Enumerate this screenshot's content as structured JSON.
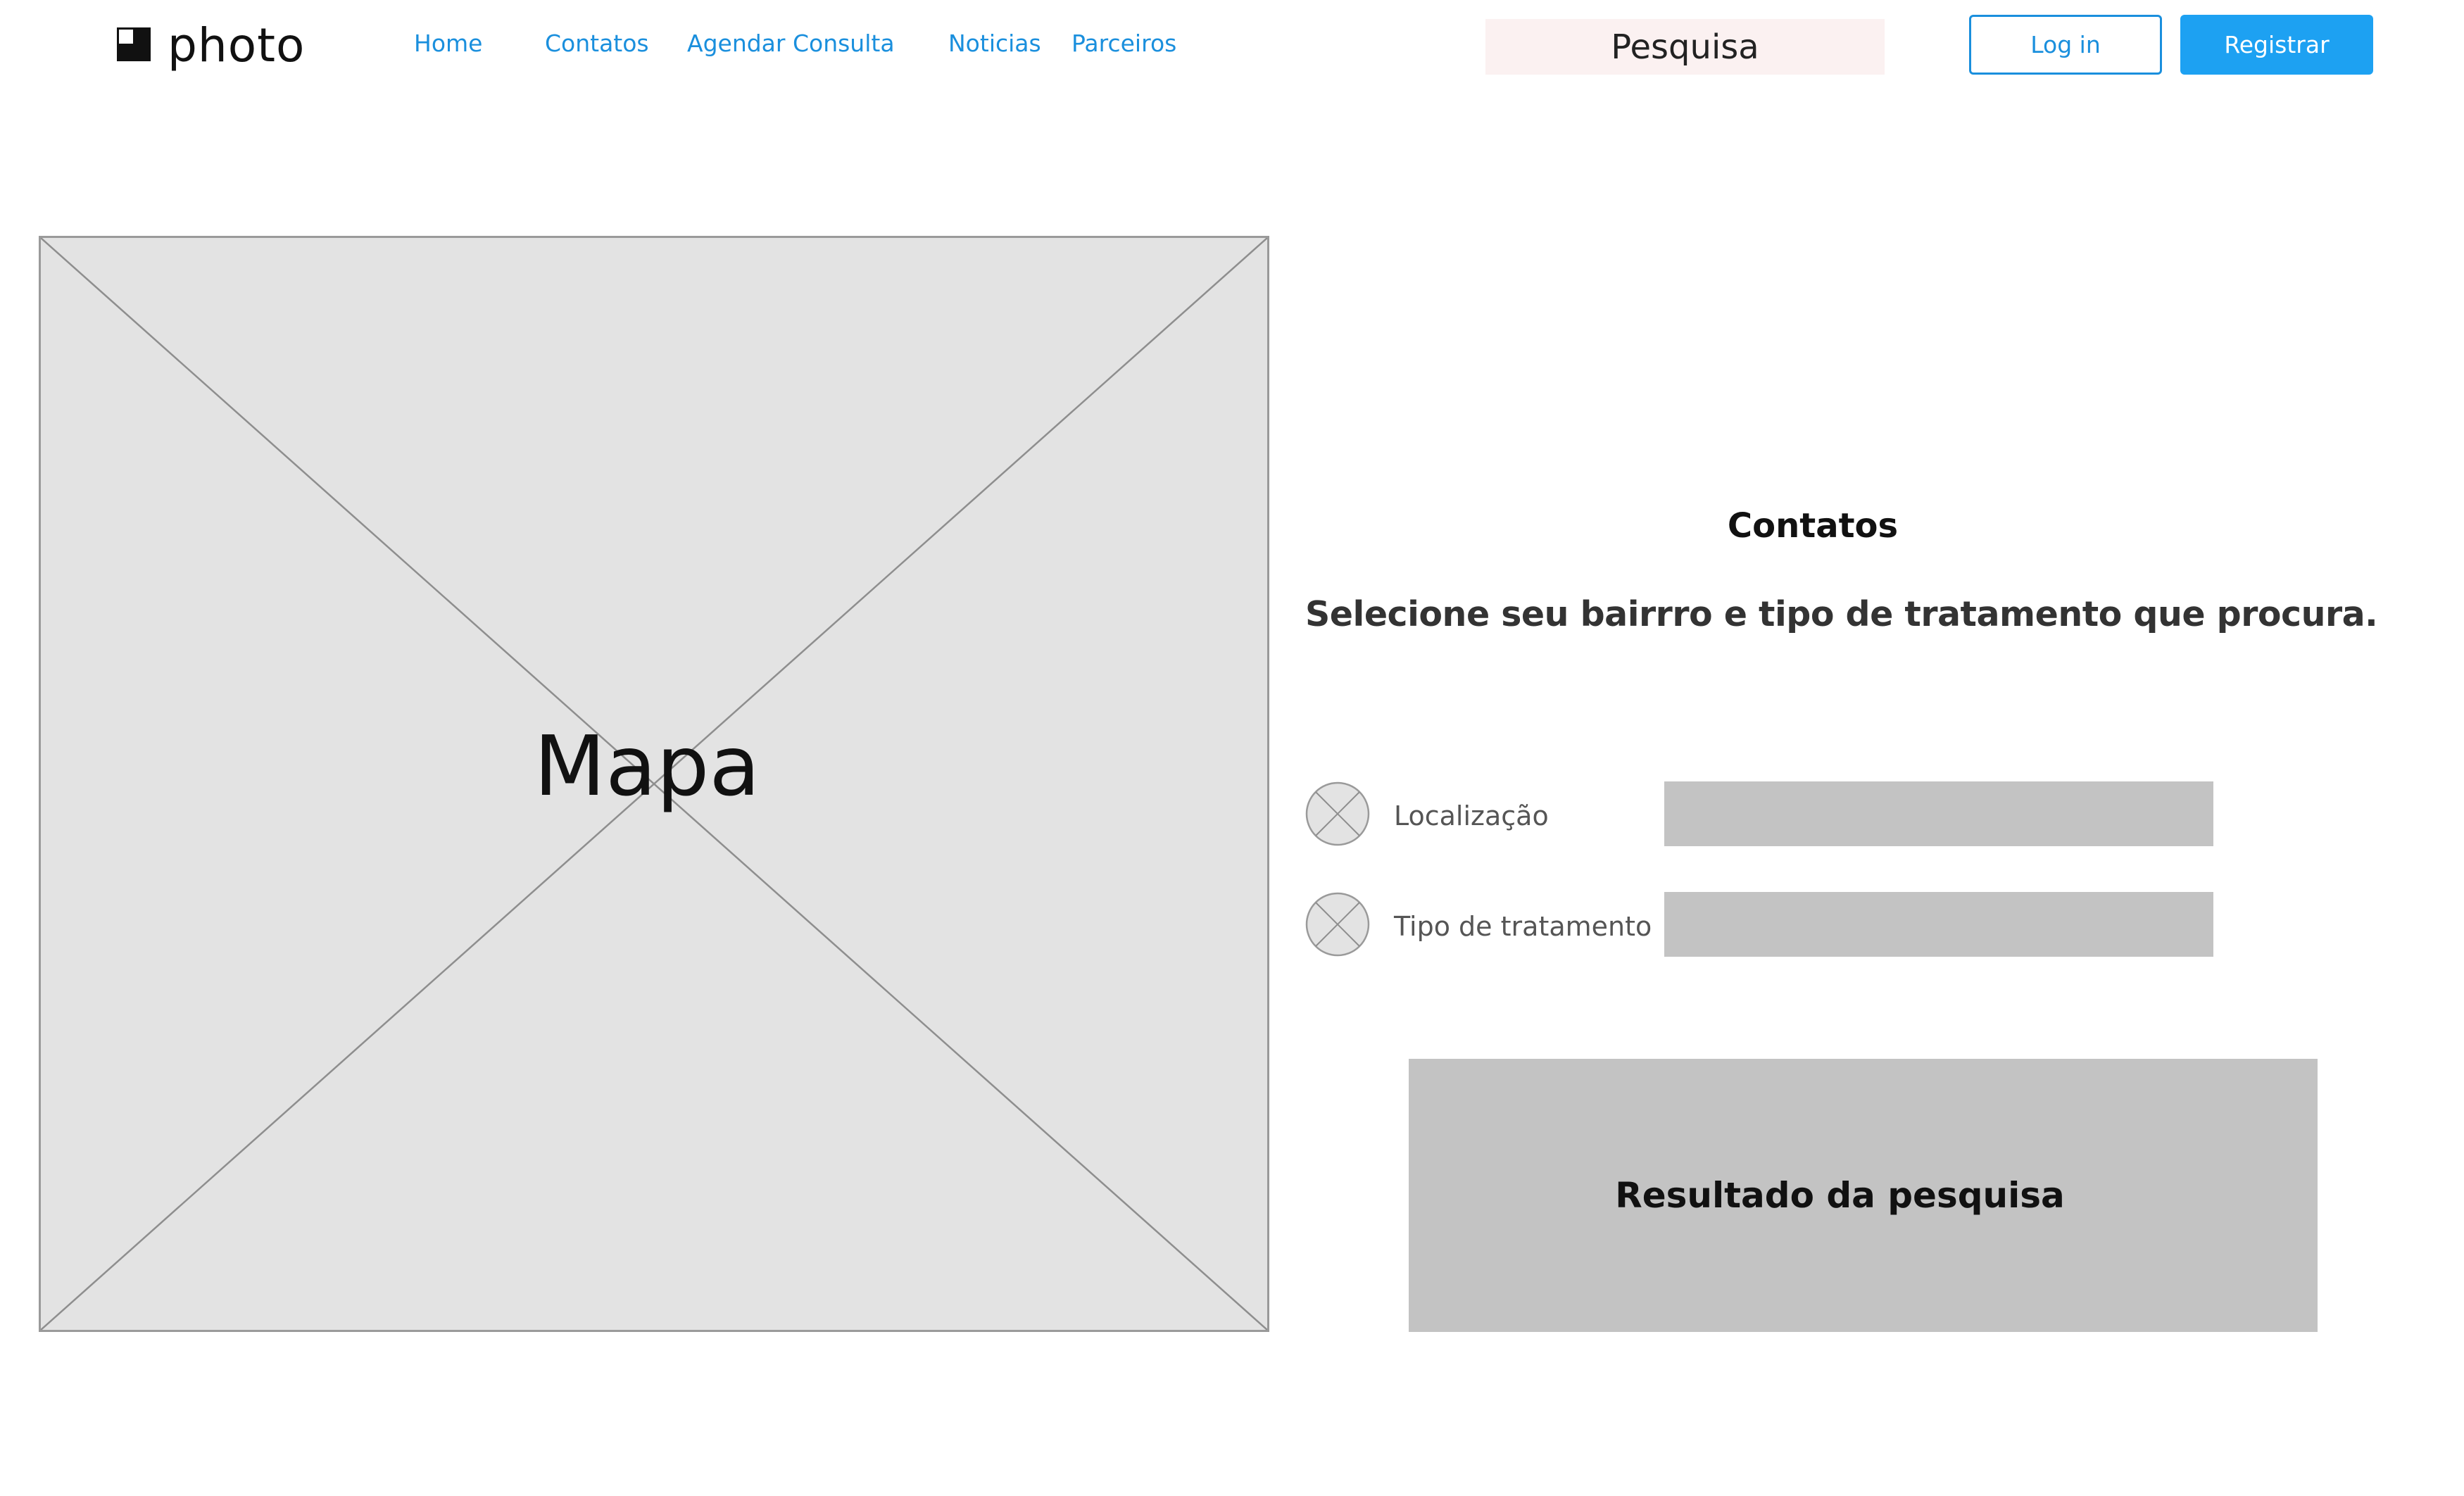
{
  "header": {
    "logo_text": "photo",
    "nav": [
      {
        "label": "Home"
      },
      {
        "label": "Contatos"
      },
      {
        "label": "Agendar Consulta"
      },
      {
        "label": "Noticias"
      },
      {
        "label": "Parceiros"
      }
    ],
    "search": {
      "placeholder": "Pesquisa",
      "value": ""
    },
    "login_label": "Log in",
    "register_label": "Registrar"
  },
  "map": {
    "label": "Mapa"
  },
  "panel": {
    "title": "Contatos",
    "subtitle": "Selecione seu bairrro e tipo de tratamento que procura.",
    "filters": [
      {
        "label": "Localização",
        "value": "",
        "icon": "placeholder-circle-icon"
      },
      {
        "label": "Tipo de tratamento",
        "value": "",
        "icon": "placeholder-circle-icon"
      }
    ],
    "results_label": "Resultado da pesquisa"
  },
  "colors": {
    "accent": "#1a8fdd",
    "register_bg": "#1da1f2",
    "search_bg": "#fbf1f1",
    "placeholder_bg": "#e3e3e3",
    "input_bg": "#c3c3c3"
  }
}
